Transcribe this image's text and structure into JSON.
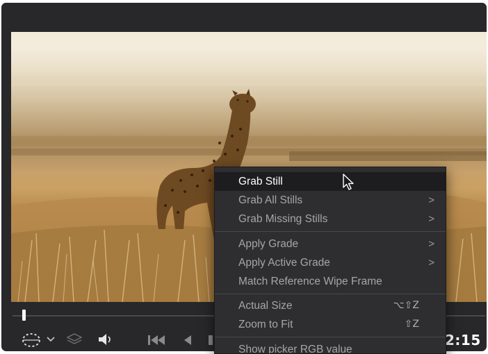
{
  "viewer": {
    "image_subject": "cheetah",
    "timecode": "2:15",
    "playhead_fraction": 0.02
  },
  "toolbar": {
    "wipe_icon": "dotted-circle-wipe-icon",
    "dropdown_icon": "chevron-down-icon",
    "layers_icon": "layers-icon",
    "volume_icon": "speaker-icon",
    "to_start_icon": "skip-to-start-icon",
    "back_icon": "play-reverse-icon",
    "stop_icon": "stop-icon"
  },
  "context_menu": {
    "items": [
      {
        "label": "Grab Still",
        "state": "hover",
        "submenu": false
      },
      {
        "label": "Grab All Stills",
        "state": "normal",
        "submenu": true,
        "arrow": ">"
      },
      {
        "label": "Grab Missing Stills",
        "state": "normal",
        "submenu": true,
        "arrow": ">"
      },
      {
        "label": "Apply Grade",
        "state": "normal",
        "submenu": true,
        "arrow": ">"
      },
      {
        "label": "Apply Active Grade",
        "state": "normal",
        "submenu": true,
        "arrow": ">"
      },
      {
        "label": "Match Reference Wipe Frame",
        "state": "normal",
        "submenu": false
      },
      {
        "label": "Actual Size",
        "state": "active",
        "shortcut": "⌥⇧Z"
      },
      {
        "label": "Zoom to Fit",
        "state": "active",
        "shortcut": "⇧Z"
      },
      {
        "label": "Show picker RGB value",
        "state": "normal"
      }
    ]
  },
  "colors": {
    "panel_bg": "#28282a",
    "menu_bg": "#2e2e30",
    "menu_hover": "#1d1d1f",
    "menu_text": "#a6a6a6",
    "menu_text_active": "#f2f2f2"
  }
}
